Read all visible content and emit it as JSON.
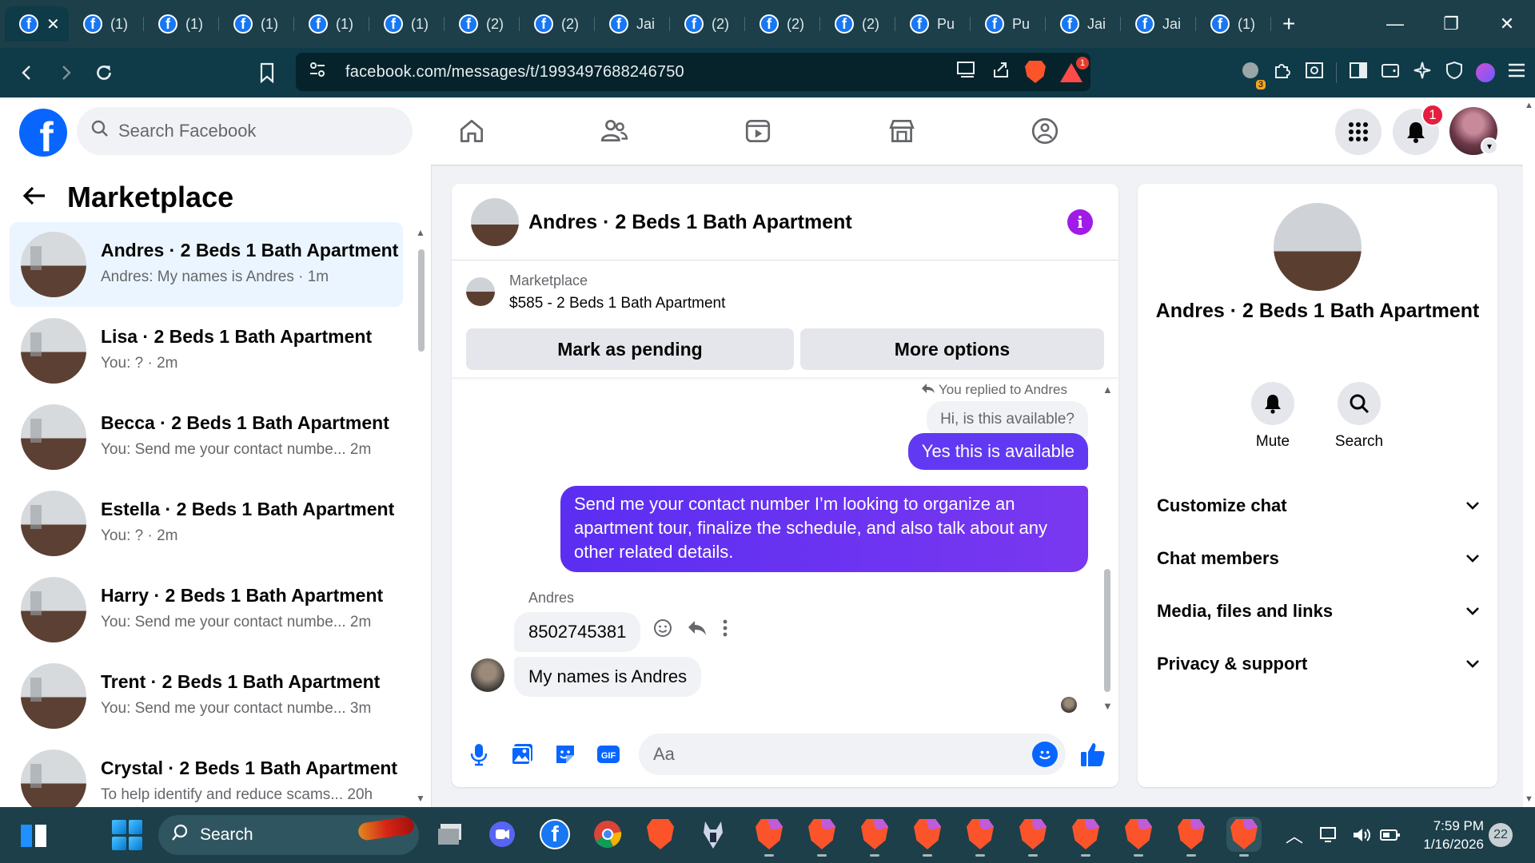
{
  "browser": {
    "tabs": [
      {
        "label": "",
        "active": true
      },
      {
        "label": "(1)"
      },
      {
        "label": "(1)"
      },
      {
        "label": "(1)"
      },
      {
        "label": "(1)"
      },
      {
        "label": "(1)"
      },
      {
        "label": "(2)"
      },
      {
        "label": "(2)"
      },
      {
        "label": "Jai"
      },
      {
        "label": "(2)"
      },
      {
        "label": "(2)"
      },
      {
        "label": "(2)"
      },
      {
        "label": "Pu"
      },
      {
        "label": "Pu"
      },
      {
        "label": "Jai"
      },
      {
        "label": "Jai"
      },
      {
        "label": "(1)"
      }
    ],
    "url": "facebook.com/messages/t/1993497688246750",
    "extension_badge": "3",
    "rewards_badge": "1"
  },
  "facebook": {
    "search_placeholder": "Search Facebook",
    "notification_count": "1",
    "sidebar": {
      "title": "Marketplace",
      "conversations": [
        {
          "name": "Andres · 2 Beds 1 Bath Apartment",
          "snippet": "Andres: My names is Andres · 1m",
          "active": true
        },
        {
          "name": "Lisa · 2 Beds 1 Bath Apartment",
          "snippet": "You: ? · 2m"
        },
        {
          "name": "Becca · 2 Beds 1 Bath Apartment",
          "snippet": "You: Send me your contact numbe...  2m"
        },
        {
          "name": "Estella · 2 Beds 1 Bath Apartment",
          "snippet": "You: ? · 2m"
        },
        {
          "name": "Harry · 2 Beds 1 Bath Apartment",
          "snippet": "You: Send me your contact numbe...  2m"
        },
        {
          "name": "Trent · 2 Beds 1 Bath Apartment",
          "snippet": "You: Send me your contact numbe...  3m"
        },
        {
          "name": "Crystal · 2 Beds 1 Bath Apartment",
          "snippet": "To help identify and reduce scams...  20h"
        }
      ]
    },
    "chat": {
      "title": "Andres · 2 Beds 1 Bath Apartment",
      "listing": {
        "label": "Marketplace",
        "price_title": "$585 - 2 Beds 1 Bath Apartment",
        "pending_button": "Mark as pending",
        "options_button": "More options"
      },
      "messages": {
        "replied_note": "You replied to Andres",
        "quoted": "Hi, is this available?",
        "out_1": "Yes this is available",
        "out_2": "Send me your contact number I’m looking to organize an apartment tour, finalize the schedule, and also talk about any other related details.",
        "sender": "Andres",
        "in_1": "8502745381",
        "in_2": "My names is Andres"
      },
      "composer_placeholder": "Aa"
    },
    "info_panel": {
      "name": "Andres · 2 Beds 1 Bath Apartment",
      "mute_label": "Mute",
      "search_label": "Search",
      "sections": [
        "Customize chat",
        "Chat members",
        "Media, files and links",
        "Privacy & support"
      ]
    }
  },
  "taskbar": {
    "search_label": "Search",
    "time": "7:59 PM",
    "date": "1/16/2026",
    "notifications": "22"
  }
}
